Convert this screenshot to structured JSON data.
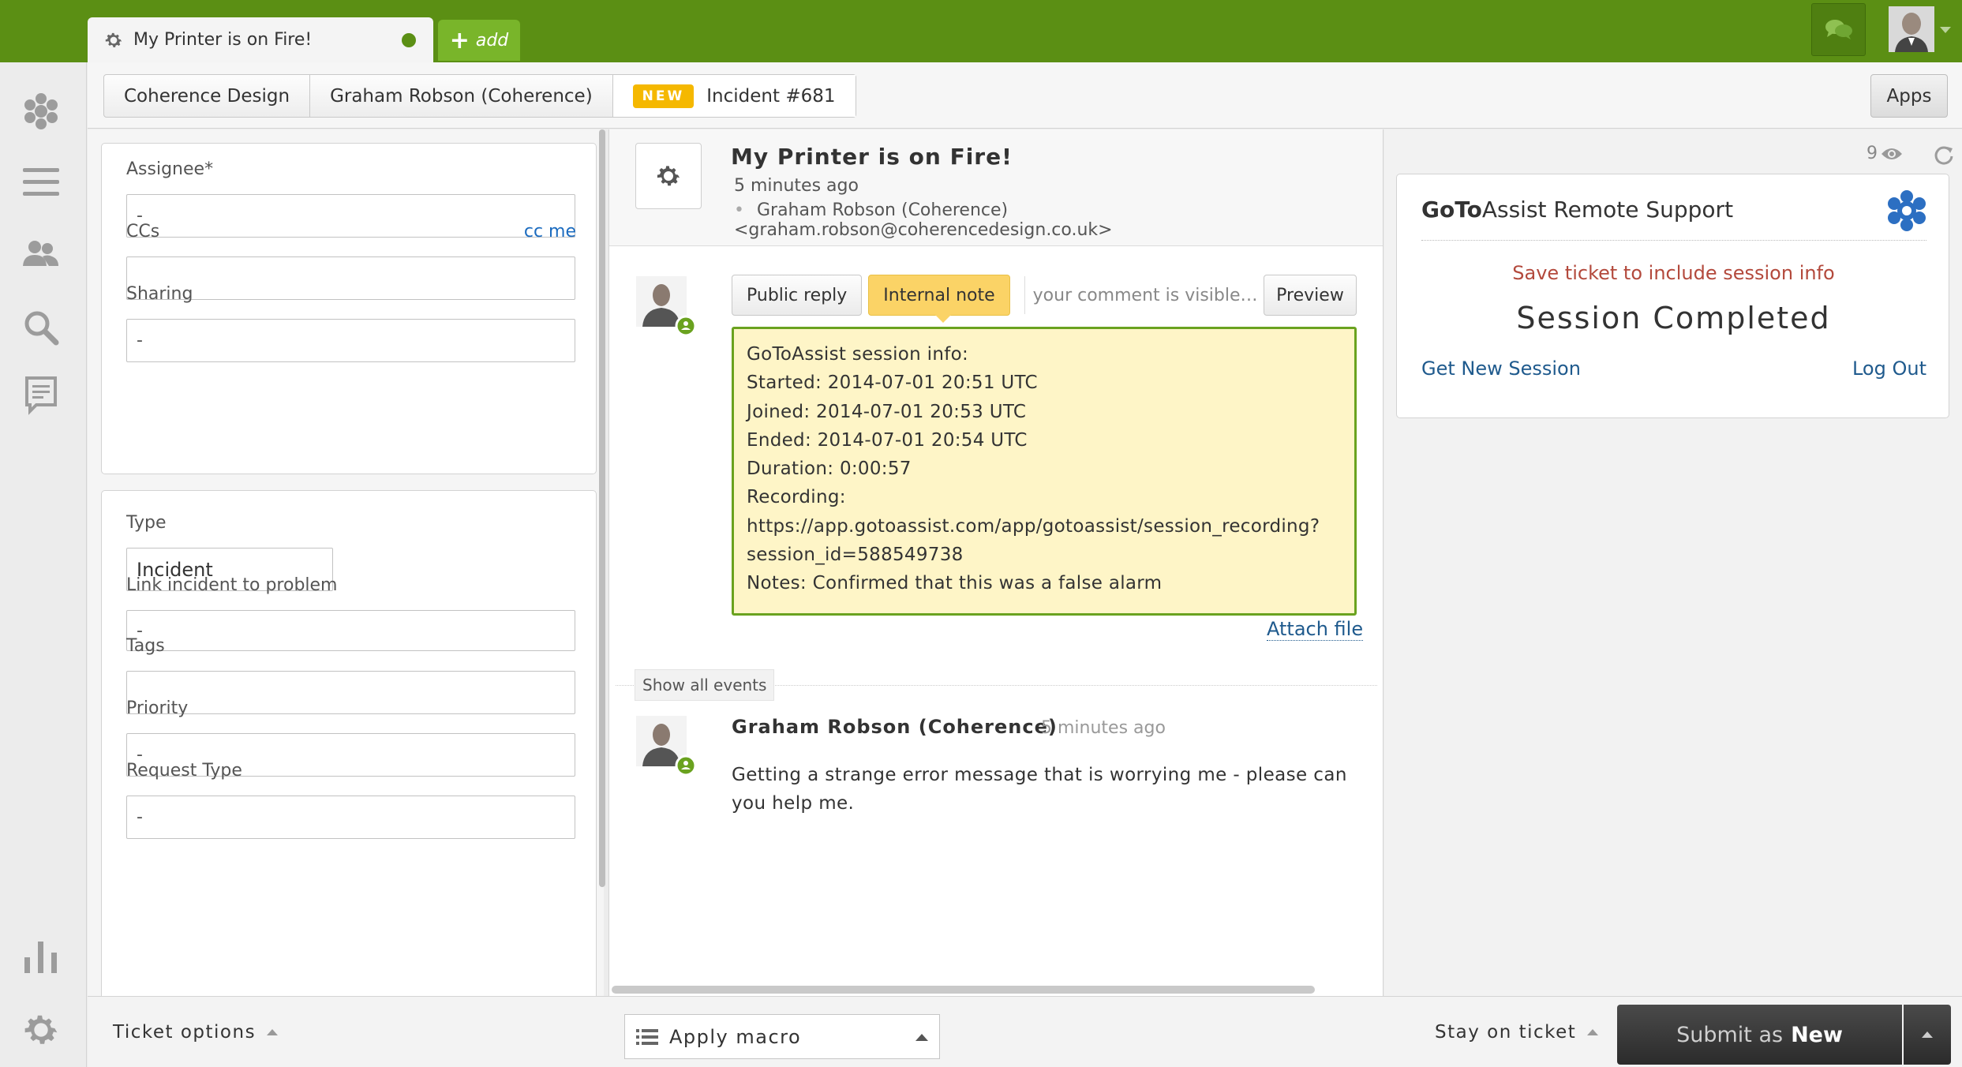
{
  "top_tabs": {
    "ticket_title": "My Printer is on Fire!",
    "add_label": "add"
  },
  "breadcrumbs": [
    {
      "label": "Coherence Design"
    },
    {
      "label": "Graham Robson (Coherence)"
    },
    {
      "badge": "NEW",
      "label": "Incident #681"
    }
  ],
  "apps_button": "Apps",
  "properties": {
    "assignee": {
      "label": "Assignee*",
      "value": "-"
    },
    "ccs": {
      "label": "CCs",
      "link": "cc me",
      "value": ""
    },
    "sharing": {
      "label": "Sharing",
      "value": "-"
    },
    "type": {
      "label": "Type",
      "value": "Incident"
    },
    "link_problem": {
      "label": "Link incident to problem",
      "value": "-"
    },
    "tags": {
      "label": "Tags",
      "value": ""
    },
    "priority": {
      "label": "Priority",
      "value": "-"
    },
    "request_type": {
      "label": "Request Type",
      "value": "-"
    }
  },
  "ticket": {
    "title": "My Printer is on Fire!",
    "time": "5 minutes ago",
    "requester": "Graham Robson (Coherence) <graham.robson@coherencedesign.co.uk>"
  },
  "composer": {
    "public_reply": "Public reply",
    "internal_note": "Internal note",
    "visibility": "your comment is visible to agents only",
    "preview": "Preview",
    "note_lines": [
      "GoToAssist session info:",
      "Started: 2014-07-01 20:51 UTC",
      "Joined: 2014-07-01 20:53 UTC",
      "Ended: 2014-07-01 20:54 UTC",
      "Duration: 0:00:57",
      "Recording:",
      "https://app.gotoassist.com/app/gotoassist/session_recording?",
      "session_id=588549738",
      "Notes: Confirmed that this was a false alarm"
    ],
    "attach_file": "Attach file"
  },
  "events": {
    "show_all": "Show all events",
    "comment_author": "Graham Robson (Coherence)",
    "comment_time": "5 minutes ago",
    "comment_body": "Getting a strange error message that is worrying me - please can you help me."
  },
  "apps_panel": {
    "view_count": "9",
    "app_title_bold": "GoTo",
    "app_title_rest": "Assist Remote Support",
    "save_message": "Save ticket to include session info",
    "session_status": "Session Completed",
    "get_new_session": "Get New Session",
    "log_out": "Log Out"
  },
  "bottom_bar": {
    "ticket_options": "Ticket options",
    "apply_macro": "Apply macro",
    "stay_on_ticket": "Stay on ticket",
    "submit_prefix": "Submit as",
    "submit_status": "New"
  },
  "colors": {
    "brand_green": "#5b8f14",
    "note_yellow": "#fef5c7",
    "note_tab": "#fbd366",
    "new_badge": "#f5b800",
    "link_blue": "#1f5a8d",
    "warning_red": "#b3493c"
  },
  "icons": {
    "ticket_tab": "gear-icon",
    "left_nav": [
      "zendesk-logo-icon",
      "views-list-icon",
      "customers-icon",
      "search-icon",
      "admin-reports-icon",
      "reporting-icon",
      "settings-gear-icon"
    ],
    "chat": "chat-bubbles-icon"
  }
}
